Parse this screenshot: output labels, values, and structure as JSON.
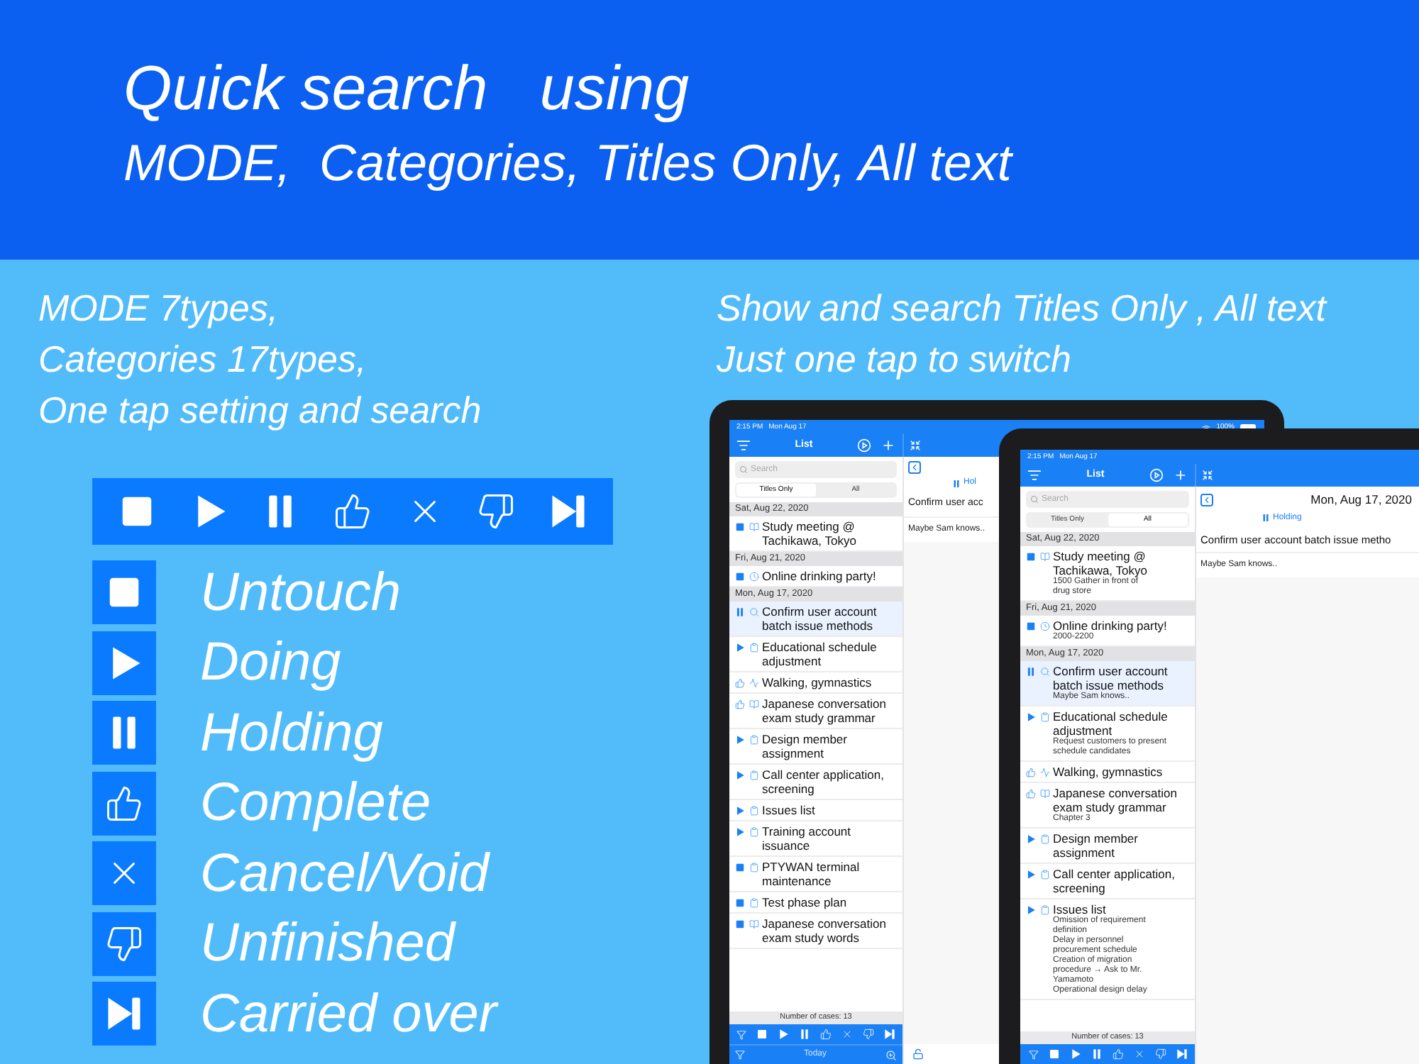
{
  "headline": {
    "line_1": "Quick search   using",
    "line_2": "MODE,  Categories, Titles Only, All text"
  },
  "left_caption": [
    "MODE 7types,",
    "Categories 17types,",
    "One tap setting and search"
  ],
  "modes": [
    {
      "kind": "untouch",
      "label": "Untouch"
    },
    {
      "kind": "doing",
      "label": "Doing"
    },
    {
      "kind": "holding",
      "label": "Holding"
    },
    {
      "kind": "complete",
      "label": "Complete"
    },
    {
      "kind": "cancel",
      "label": "Cancel/Void"
    },
    {
      "kind": "unfinished",
      "label": "Unfinished"
    },
    {
      "kind": "carried",
      "label": "Carried over"
    }
  ],
  "right_caption": [
    "Show and search Titles Only , All text",
    "Just one tap to switch"
  ],
  "tablets": [
    {
      "status_time": "2:15 PM",
      "status_date": "Mon Aug 17",
      "battery": "100%",
      "nav_title": "List",
      "search_placeholder": "Search",
      "segments": [
        {
          "label": "Titles Only",
          "selected": true
        },
        {
          "label": "All",
          "selected": false
        }
      ],
      "sections": [
        {
          "date": "Sat, Aug 22, 2020",
          "items": [
            {
              "mode": {
                "kind": "untouch"
              },
              "category": {
                "kind": "book"
              },
              "title": "Study meeting @ Tachikawa, Tokyo",
              "selected": false
            }
          ]
        },
        {
          "date": "Fri, Aug 21, 2020",
          "items": [
            {
              "mode": {
                "kind": "untouch"
              },
              "category": {
                "kind": "clock"
              },
              "title": "Online drinking party!",
              "selected": false
            }
          ]
        },
        {
          "date": "Mon, Aug 17, 2020",
          "items": [
            {
              "mode": {
                "kind": "holding"
              },
              "category": {
                "kind": "search"
              },
              "title": "Confirm user account batch issue methods",
              "selected": true
            },
            {
              "mode": {
                "kind": "doing"
              },
              "category": {
                "kind": "bag"
              },
              "title": "Educational schedule adjustment",
              "selected": false
            },
            {
              "mode": {
                "kind": "complete"
              },
              "category": {
                "kind": "pulse"
              },
              "title": "Walking, gymnastics",
              "selected": false
            },
            {
              "mode": {
                "kind": "complete"
              },
              "category": {
                "kind": "book"
              },
              "title": "Japanese conversation exam study grammar",
              "selected": false
            },
            {
              "mode": {
                "kind": "doing"
              },
              "category": {
                "kind": "bag"
              },
              "title": "Design member assignment",
              "selected": false
            },
            {
              "mode": {
                "kind": "doing"
              },
              "category": {
                "kind": "bag"
              },
              "title": "Call center application, screening",
              "selected": false
            },
            {
              "mode": {
                "kind": "doing"
              },
              "category": {
                "kind": "bag"
              },
              "title": "Issues list",
              "selected": false
            },
            {
              "mode": {
                "kind": "doing"
              },
              "category": {
                "kind": "bag"
              },
              "title": "Training account issuance",
              "selected": false
            },
            {
              "mode": {
                "kind": "untouch"
              },
              "category": {
                "kind": "bag"
              },
              "title": "PTYWAN terminal maintenance",
              "selected": false
            },
            {
              "mode": {
                "kind": "untouch"
              },
              "category": {
                "kind": "bag"
              },
              "title": "Test phase plan",
              "selected": false
            },
            {
              "mode": {
                "kind": "untouch"
              },
              "category": {
                "kind": "book"
              },
              "title": "Japanese conversation exam study words",
              "selected": false
            }
          ]
        }
      ],
      "count": "Number of cases: 13",
      "bottom_label": "Today",
      "detail": {
        "status": "Hol",
        "title": "Confirm user acc",
        "note": "Maybe Sam knows.."
      }
    },
    {
      "status_time": "2:15 PM",
      "status_date": "Mon Aug 17",
      "nav_title": "List",
      "search_placeholder": "Search",
      "segments": [
        {
          "label": "Titles Only",
          "selected": false
        },
        {
          "label": "All",
          "selected": true
        }
      ],
      "sections": [
        {
          "date": "Sat, Aug 22, 2020",
          "items": [
            {
              "mode": {
                "kind": "untouch"
              },
              "category": {
                "kind": "book"
              },
              "title": "Study meeting @ Tachikawa, Tokyo",
              "note": [
                "1500 Gather in front of",
                "drug store"
              ],
              "selected": false
            }
          ]
        },
        {
          "date": "Fri, Aug 21, 2020",
          "items": [
            {
              "mode": {
                "kind": "untouch"
              },
              "category": {
                "kind": "clock"
              },
              "title": "Online drinking party!",
              "note": [
                "2000-2200"
              ],
              "selected": false
            }
          ]
        },
        {
          "date": "Mon, Aug 17, 2020",
          "items": [
            {
              "mode": {
                "kind": "holding"
              },
              "category": {
                "kind": "search"
              },
              "title": "Confirm user account batch issue methods",
              "note": [
                "Maybe Sam knows.."
              ],
              "selected": true
            },
            {
              "mode": {
                "kind": "doing"
              },
              "category": {
                "kind": "bag"
              },
              "title": "Educational schedule adjustment",
              "note": [
                "Request customers to present",
                "schedule candidates"
              ],
              "selected": false
            },
            {
              "mode": {
                "kind": "complete"
              },
              "category": {
                "kind": "pulse"
              },
              "title": "Walking, gymnastics",
              "selected": false
            },
            {
              "mode": {
                "kind": "complete"
              },
              "category": {
                "kind": "book"
              },
              "title": "Japanese conversation exam study grammar",
              "note": [
                "Chapter 3"
              ],
              "selected": false
            },
            {
              "mode": {
                "kind": "doing"
              },
              "category": {
                "kind": "bag"
              },
              "title": "Design member assignment",
              "selected": false
            },
            {
              "mode": {
                "kind": "doing"
              },
              "category": {
                "kind": "bag"
              },
              "title": "Call center application, screening",
              "selected": false
            },
            {
              "mode": {
                "kind": "doing"
              },
              "category": {
                "kind": "bag"
              },
              "title": "Issues list",
              "note": [
                "Omission of requirement",
                "definition",
                "Delay in personnel",
                "procurement schedule",
                "Creation of migration",
                "procedure → Ask to Mr.",
                "Yamamoto",
                "Operational design delay"
              ],
              "selected": false
            }
          ]
        }
      ],
      "count": "Number of cases: 13",
      "detail": {
        "date": "Mon, Aug 17, 2020",
        "status": "Holding",
        "title": "Confirm user account batch issue metho",
        "note": "Maybe Sam knows.."
      }
    }
  ]
}
